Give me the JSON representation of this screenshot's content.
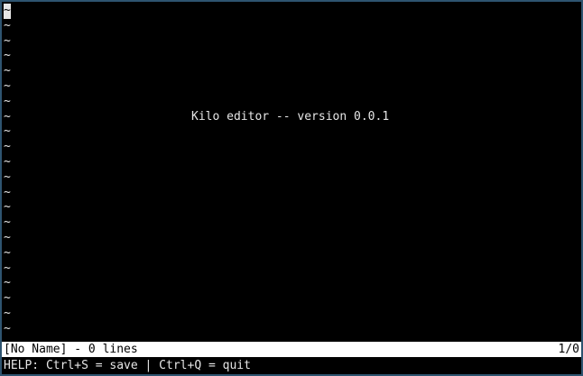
{
  "editor": {
    "tilde": "~",
    "welcome": "Kilo editor -- version 0.0.1",
    "welcome_row": 7,
    "row_count": 22
  },
  "status": {
    "left": "[No Name] - 0 lines",
    "right": "1/0"
  },
  "message": {
    "help": "HELP: Ctrl+S = save | Ctrl+Q = quit"
  },
  "colors": {
    "background": "#000000",
    "foreground": "#e6e6e6",
    "status_bg": "#ffffff",
    "status_fg": "#000000",
    "frame": "#2e5470"
  }
}
